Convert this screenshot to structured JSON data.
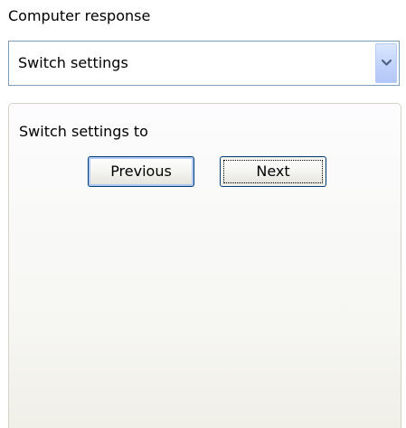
{
  "response_section": {
    "label": "Computer response",
    "dropdown": {
      "selected": "Switch settings",
      "icon": "chevron-down-icon"
    }
  },
  "settings_panel": {
    "label": "Switch settings to",
    "buttons": {
      "previous_label": "Previous",
      "next_label": "Next"
    }
  },
  "colors": {
    "border_blue": "#7f9db9",
    "button_border": "#003c74",
    "panel_border": "#d6d3c4"
  }
}
